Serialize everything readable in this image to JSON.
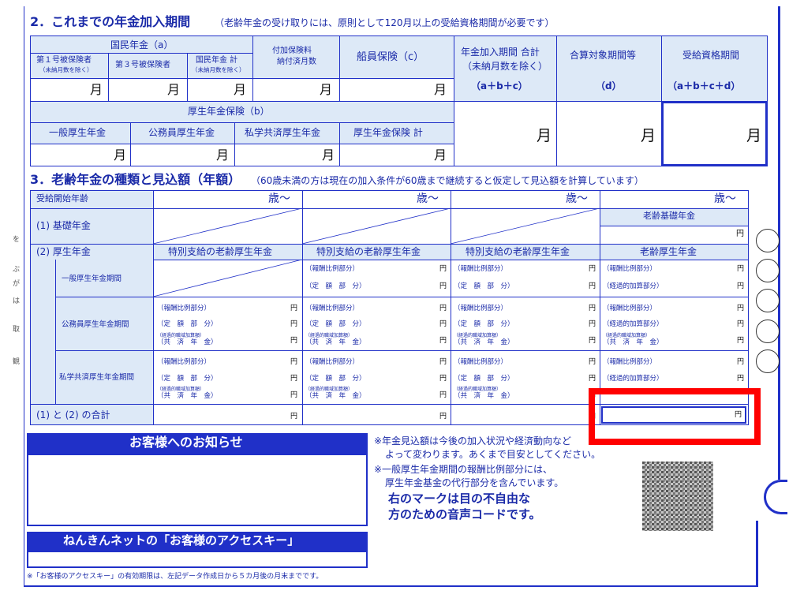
{
  "section2": {
    "title": "2．これまでの年金加入期間",
    "note": "（老齢年金の受け取りには、原則として120月以上の受給資格期間が必要です）",
    "kokumin": "国民年金（a）",
    "dai1": "第１号被保険者",
    "dai1_sub": "（未納月数を除く）",
    "dai3": "第３号被保険者",
    "kokumin_total": "国民年金 計",
    "kokumin_total_sub": "（未納月数を除く）",
    "fuka1": "付加保険料",
    "fuka2": "納付済月数",
    "senin": "船員保険（c）",
    "nenkin_total1": "年金加入期間 合計",
    "nenkin_total2": "（未納月数を除く）",
    "nenkin_total3": "（a＋b＋c）",
    "gassan1": "合算対象期間等",
    "gassan2": "（d）",
    "jukyu1": "受給資格期間",
    "jukyu2": "（a＋b＋c＋d）",
    "kosei": "厚生年金保険（b）",
    "ippan": "一般厚生年金",
    "komuin": "公務員厚生年金",
    "shigaku": "私学共済厚生年金",
    "kosei_total": "厚生年金保険 計",
    "month": "月"
  },
  "section3": {
    "title": "3．老齢年金の種類と見込額（年額）",
    "note": "（60歳未満の方は現在の加入条件が60歳まで継続すると仮定して見込額を計算しています）",
    "start_age": "受給開始年齢",
    "age_suffix": "歳〜",
    "kiso": "(1) 基礎年金",
    "kosei": "(2) 厚生年金",
    "rourei_kiso": "老齢基礎年金",
    "tokubetsu": "特別支給の老齢厚生年金",
    "rourei_kosei": "老齢厚生年金",
    "ippan_period": "一般厚生年金期間",
    "komuin_period": "公務員厚生年金期間",
    "shigaku_period": "私学共済厚生年金期間",
    "hoshu": "（報酬比例部分）",
    "teigaku": "（定　額　部　分）",
    "keika": "（経過的加算部分）",
    "keika_small": "（経過的職域加算額）",
    "kyosai": "（共　済　年　金）",
    "total": "(1) と (2) の合計",
    "yen": "円"
  },
  "notice": {
    "title": "お客様へのお知らせ",
    "line1": "※年金見込額は今後の加入状況や経済動向など",
    "line2": "よって変わります。あくまで目安としてください。",
    "line3": "※一般厚生年金期間の報酬比例部分には、",
    "line4": "厚生年金基金の代行部分を含んでいます。",
    "voice1": "右のマークは目の不自由な",
    "voice2": "方のための音声コードです。"
  },
  "access": {
    "title": "ねんきんネットの「お客様のアクセスキー」",
    "footnote": "※「お客様のアクセスキー」の有効期限は、左記データ作成日から５カ月後の月末までです。"
  },
  "side_text": [
    "を",
    "ぶ",
    "が",
    "は",
    "取",
    "観"
  ],
  "colors": {
    "blue": "#2030c8",
    "light": "#dde9f7",
    "highlight": "#ff0000"
  }
}
